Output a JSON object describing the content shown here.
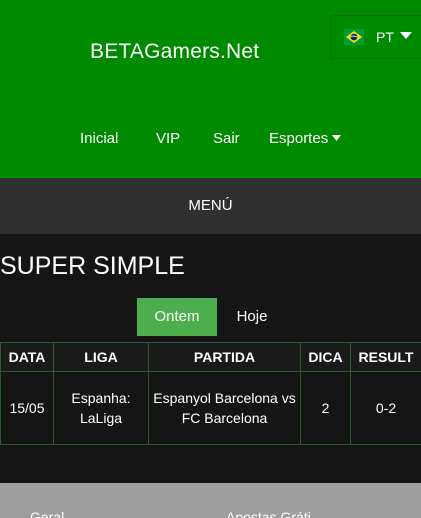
{
  "header": {
    "brand": "BETAGamers.Net",
    "language": {
      "label": "PT",
      "flag_icon": "brazil-flag-icon"
    },
    "nav": [
      {
        "label": "Inicial"
      },
      {
        "label": "VIP"
      },
      {
        "label": "Sair"
      },
      {
        "label": "Esportes"
      }
    ]
  },
  "menu_label": "MENÚ",
  "page_title": "SUPER SIMPLE",
  "tabs": [
    {
      "label": "Ontem",
      "active": true
    },
    {
      "label": "Hoje",
      "active": false
    }
  ],
  "table": {
    "columns": [
      "DATA",
      "LIGA",
      "PARTIDA",
      "DICA",
      "RESULT"
    ],
    "rows": [
      {
        "data": "15/05",
        "liga": "Espanha: LaLiga",
        "partida": "Espanyol Barcelona vs FC Barcelona",
        "dica": "2",
        "result": "0-2"
      }
    ]
  },
  "footer": {
    "left_text": "Geral",
    "right_text": "Apostas Gráti"
  },
  "colors": {
    "brand_green": "#008a00",
    "active_tab": "#4cae4c",
    "menubar": "#303030",
    "background": "#151515",
    "footer": "#9e9e9e"
  }
}
